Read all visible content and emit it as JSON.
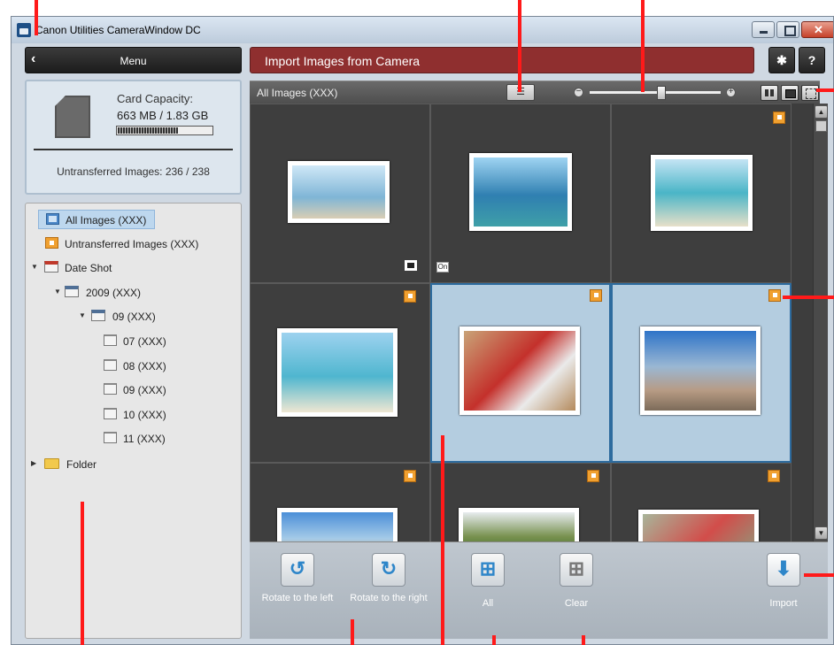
{
  "window": {
    "title": "Canon Utilities CameraWindow DC"
  },
  "left": {
    "menu_label": "Menu",
    "card": {
      "capacity_label": "Card Capacity:",
      "capacity_value": "663 MB / 1.83 GB",
      "used_fraction": 0.64,
      "untransferred": "Untransferred Images: 236 / 238"
    },
    "tree": [
      {
        "label": "All Images (XXX)"
      },
      {
        "label": "Untransferred Images (XXX)"
      },
      {
        "label": "Date Shot"
      },
      {
        "label": "2009 (XXX)"
      },
      {
        "label": "09 (XXX)"
      },
      {
        "label": "07 (XXX)"
      },
      {
        "label": "08 (XXX)"
      },
      {
        "label": "09 (XXX)"
      },
      {
        "label": "10 (XXX)"
      },
      {
        "label": "11 (XXX)"
      },
      {
        "label": "Folder"
      }
    ]
  },
  "header": {
    "title": "Import Images from Camera",
    "settings_icon": "gear-icon",
    "help_label": "?"
  },
  "toolbar": {
    "title": "All Images (XXX)",
    "zoom_level": 0.55
  },
  "actions": [
    {
      "label": "Rotate to the left",
      "icon": "rotate-left-icon"
    },
    {
      "label": "Rotate to the right",
      "icon": "rotate-right-icon"
    },
    {
      "label": "All",
      "icon": "select-all-icon"
    },
    {
      "label": "Clear",
      "icon": "clear-selection-icon"
    },
    {
      "label": "Import",
      "icon": "import-icon"
    }
  ],
  "colors": {
    "header_red": "#8f2f2f",
    "selection_blue": "#b4cde0",
    "badge_orange": "#f0a030",
    "annotation_red": "#ff1a1a"
  }
}
